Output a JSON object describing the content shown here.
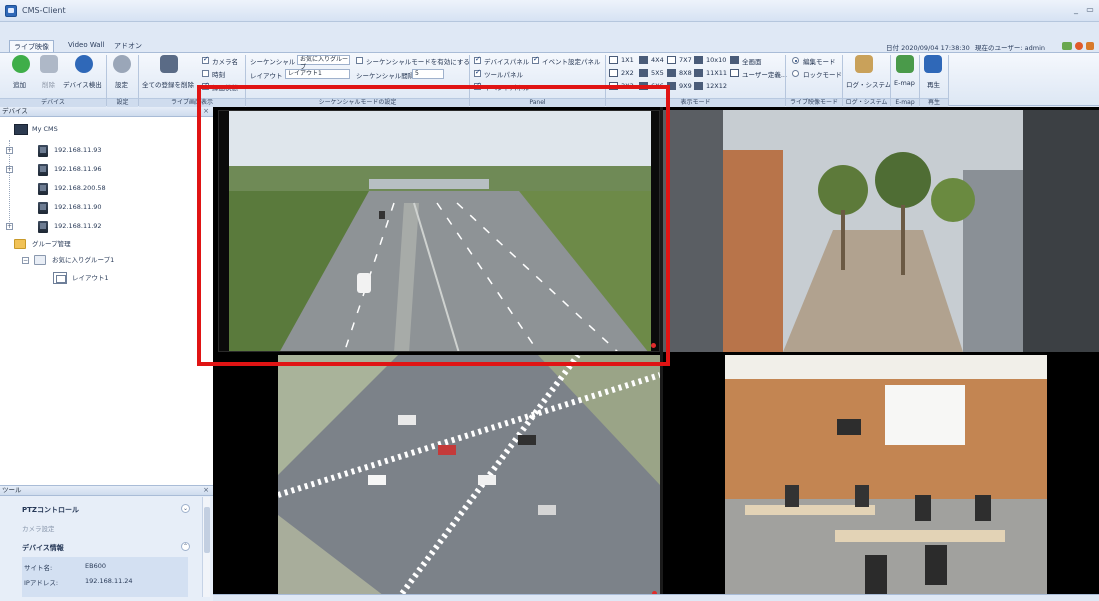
{
  "window": {
    "title": "CMS-Client",
    "minimize_glyph": "_",
    "restore_glyph": "▭"
  },
  "ribbon_tabs": [
    "ライブ映像",
    "Video Wall",
    "アドオン"
  ],
  "header": {
    "datetime_label": "日付 2020/09/04 17:38:30",
    "user_label": "現在のユーザー: admin"
  },
  "device_group": {
    "add_label": "追加",
    "delete_label": "削除",
    "detect_label": "デバイス検出",
    "group_label": "デバイス"
  },
  "settings_group": {
    "settings_label": "設定",
    "group_label": "設定"
  },
  "display_group": {
    "delete_all_label": "全ての登録を削除",
    "camera_name_label": "カメラ名",
    "time_label": "時刻",
    "snapshot_label": "録画状態",
    "group_label": "ライブ画面表示"
  },
  "sequence_group": {
    "sequential_label": "シーケンシャル",
    "group_combo_value": "お気に入りグループ",
    "disable_label": "シーケンシャルモードを有効にする",
    "layout_label": "レイアウト",
    "layout_combo_value": "レイアウト1",
    "interval_label": "シーケンシャル間隔",
    "interval_value": "5",
    "group_label": "シーケンシャルモードの設定"
  },
  "panel_group": {
    "device_panel_label": "デバイスパネル",
    "event_panel_label": "イベント設定パネル",
    "tool_panel_label": "ツールパネル",
    "event_log_label": "イベントパネル",
    "group_label": "Panel"
  },
  "view_mode_group": {
    "modes": [
      "1X1",
      "4X4",
      "7X7",
      "10x10",
      "全画面",
      "2X2",
      "5X5",
      "8X8",
      "11X11",
      "ユーザー定義...",
      "3X3",
      "6X6",
      "9X9",
      "12X12"
    ],
    "group_label": "表示モード"
  },
  "live_mode_group": {
    "edit_mode_label": "編集モード",
    "lock_mode_label": "ロックモード",
    "group_label": "ライブ映像モード"
  },
  "system_group": {
    "log_label": "ログ・システム",
    "group_label": "ログ・システム"
  },
  "emap_group": {
    "emap_label": "E-map",
    "group_label": "E-map"
  },
  "playback_group": {
    "play_label": "再生",
    "group_label": "再生"
  },
  "device_panel": {
    "title": "デバイス",
    "root_label": "My CMS",
    "devices": [
      "192.168.11.93",
      "192.168.11.96",
      "192.168.200.58",
      "192.168.11.90",
      "192.168.11.92"
    ],
    "group_mgmt_label": "グループ管理",
    "fav_group_label": "お気に入りグループ1",
    "layout_item_label": "レイアウト1"
  },
  "tool_panel": {
    "title": "ツール",
    "ptz_label": "PTZコントロール",
    "camera_settings_label": "カメラ設定",
    "device_info_label": "デバイス情報",
    "site_name_key": "サイト名:",
    "site_name_value": "EB600",
    "ip_key": "IPアドレス:",
    "ip_value": "192.168.11.24"
  },
  "colors": {
    "accent": "#2f68b8",
    "highlight": "#e01414",
    "rec_dot": "#e02b2b"
  }
}
